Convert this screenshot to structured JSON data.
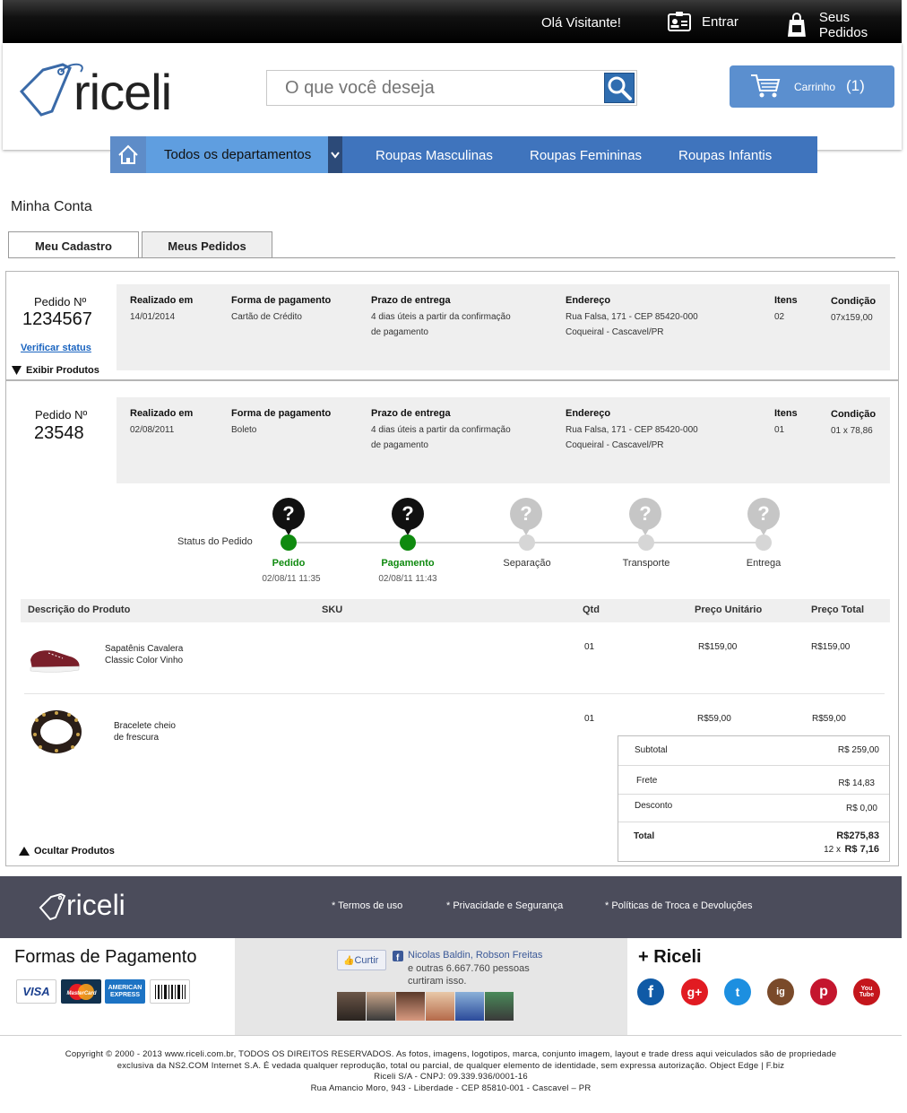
{
  "topbar": {
    "greeting": "Olá Visitante!",
    "login": "Entrar",
    "orders": "Seus Pedidos"
  },
  "header": {
    "logo": "riceli",
    "search_placeholder": "O que você deseja",
    "cart": {
      "label": "Carrinho",
      "count": "(1)"
    }
  },
  "nav": {
    "departments": "Todos os departamentos",
    "items": [
      "Roupas Masculinas",
      "Roupas Femininas",
      "Roupas Infantis"
    ]
  },
  "account": {
    "title": "Minha Conta",
    "tabs": [
      "Meu Cadastro",
      "Meus Pedidos"
    ]
  },
  "columns": {
    "date": "Realizado em",
    "payment": "Forma de pagamento",
    "deadline": "Prazo de entrega",
    "address": "Endereço",
    "items": "Itens",
    "condition": "Condição"
  },
  "orders": [
    {
      "label": "Pedido Nº",
      "number": "1234567",
      "date": "14/01/2014",
      "payment": "Cartão de Crédito",
      "deadline_1": "4 dias úteis a partir da confirmação",
      "deadline_2": "de pagamento",
      "address_1": "Rua Falsa, 171 - CEP 85420-000",
      "address_2": "Coqueiral - Cascavel/PR",
      "items": "02",
      "condition": "07x159,00",
      "status_link": "Verificar status",
      "toggle": "Exibir Produtos"
    },
    {
      "label": "Pedido Nº",
      "number": "23548",
      "date": "02/08/2011",
      "payment": "Boleto",
      "deadline_1": "4 dias úteis a partir da confirmação",
      "deadline_2": "de pagamento",
      "address_1": "Rua Falsa, 171 - CEP 85420-000",
      "address_2": "Coqueiral - Cascavel/PR",
      "items": "01",
      "condition": "01 x 78,86",
      "toggle": "Ocultar Produtos"
    }
  ],
  "tracking": {
    "label": "Status do Pedido",
    "steps": [
      {
        "name": "Pedido",
        "date": "02/08/11 11:35",
        "done": true
      },
      {
        "name": "Pagamento",
        "date": "02/08/11 11:43",
        "done": true
      },
      {
        "name": "Separação",
        "date": "",
        "done": false
      },
      {
        "name": "Transporte",
        "date": "",
        "done": false
      },
      {
        "name": "Entrega",
        "date": "",
        "done": false
      }
    ],
    "question_mark": "?"
  },
  "products": {
    "headers": {
      "description": "Descrição do Produto",
      "sku": "SKU",
      "qty": "Qtd",
      "unit": "Preço Unitário",
      "total": "Preço Total"
    },
    "rows": [
      {
        "name_1": "Sapatênis Cavalera",
        "name_2": "Classic Color Vinho",
        "qty": "01",
        "unit": "R$159,00",
        "total": "R$159,00"
      },
      {
        "name_1": "Bracelete cheio",
        "name_2": "de frescura",
        "qty": "01",
        "unit": "R$59,00",
        "total": "R$59,00"
      }
    ]
  },
  "totals": {
    "subtotal_label": "Subtotal",
    "subtotal": "R$ 259,00",
    "frete_label": "Frete",
    "frete": "R$ 14,83",
    "desconto_label": "Desconto",
    "desconto": "R$ 0,00",
    "total_label": "Total",
    "total": "R$275,83",
    "installments_prefix": "12 x",
    "installments_value": "R$ 7,16"
  },
  "footer": {
    "logo": "riceli",
    "links": [
      "* Termos de uso",
      "* Privacidade e Segurança",
      "* Políticas de Troca e Devoluções"
    ],
    "payment_title": "Formas de Pagamento",
    "cards": [
      "VISA",
      "MasterCard",
      "AMERICAN EXPRESS"
    ],
    "fb_like": "Curtir",
    "fb_names": "Nicolas Baldin, Robson Freitas",
    "fb_more_1": "e outras 6.667.760 pessoas",
    "fb_more_2": "curtiram isso.",
    "plus_title": "+ Riceli",
    "social": [
      "f",
      "g+",
      "t",
      "ig",
      "p",
      "You Tube"
    ],
    "copyright": [
      "Copyright © 2000 - 2013 www.riceli.com.br, TODOS OS DIREITOS RESERVADOS. As fotos, imagens, logotipos, marca, conjunto imagem, layout e trade dress aqui veiculados são de propriedade",
      "exclusiva da NS2.COM Internet S.A. É vedada qualquer reprodução, total ou parcial, de qualquer elemento de identidade, sem expressa autorização. Object Edge | F.biz",
      "Riceli S/A - CNPJ: 09.339.936/0001-16",
      "Rua Amancio Moro, 943 - Liberdade - CEP 85810-001 - Cascavel – PR"
    ]
  },
  "colors": {
    "brand_blue": "#3f74bd",
    "cart_blue": "#5b8fcf",
    "done_green": "#0f8a0f",
    "footer_dark": "#4b4c5b"
  }
}
